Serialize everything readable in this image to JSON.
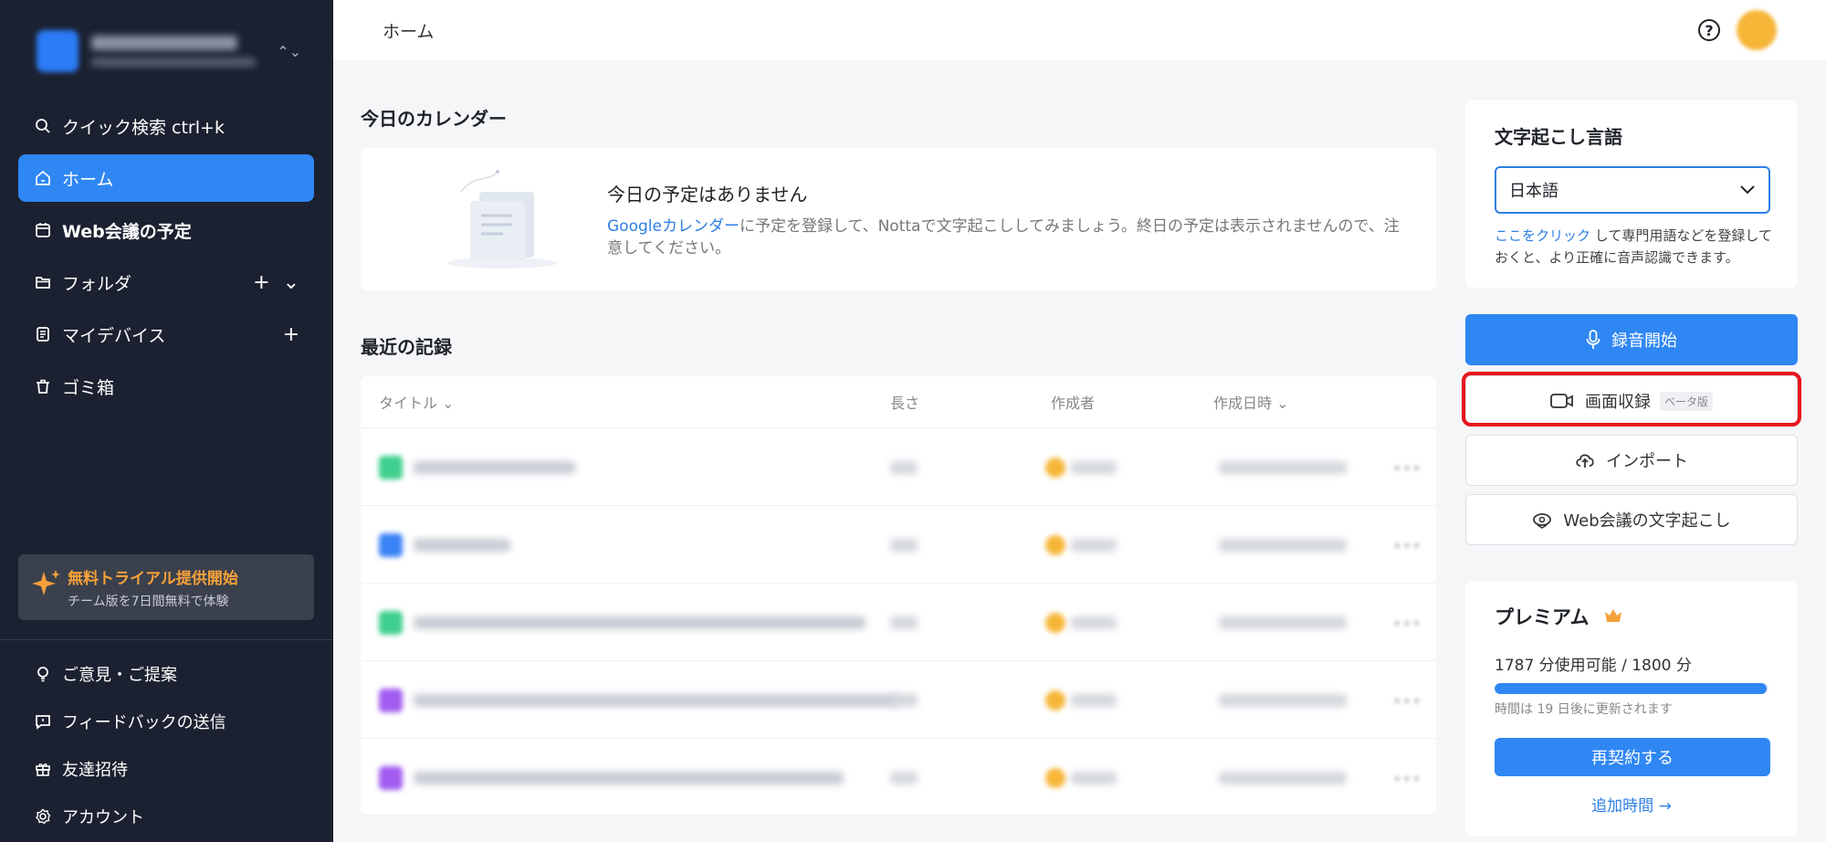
{
  "sidebar": {
    "workspace_toggle": "⌃⌄",
    "nav": [
      {
        "label": "クイック検索 ctrl+k",
        "icon": "search-icon"
      },
      {
        "label": "ホーム",
        "icon": "home-icon",
        "active": true
      },
      {
        "label": "Web会議の予定",
        "icon": "calendar-icon"
      },
      {
        "label": "フォルダ",
        "icon": "folder-icon",
        "actions": [
          "+",
          "⌄"
        ]
      },
      {
        "label": "マイデバイス",
        "icon": "device-icon",
        "actions": [
          "+"
        ]
      },
      {
        "label": "ゴミ箱",
        "icon": "trash-icon"
      }
    ],
    "trial": {
      "title": "無料トライアル提供開始",
      "subtitle": "チーム版を7日間無料で体験",
      "icon": "sparkle-icon"
    },
    "bottom": [
      {
        "label": "ご意見・ご提案",
        "icon": "lightbulb-icon"
      },
      {
        "label": "フィードバックの送信",
        "icon": "feedback-icon"
      },
      {
        "label": "友達招待",
        "icon": "gift-icon"
      },
      {
        "label": "アカウント",
        "icon": "gear-icon"
      }
    ]
  },
  "topbar": {
    "breadcrumb": "ホーム",
    "help": "?"
  },
  "calendar": {
    "section_title": "今日のカレンダー",
    "empty_title": "今日の予定はありません",
    "desc_link": "Googleカレンダー",
    "desc_rest": "に予定を登録して、Nottaで文字起こししてみましょう。終日の予定は表示されませんので、注意してください。"
  },
  "records": {
    "section_title": "最近の記録",
    "columns": {
      "title": "タイトル ⌄",
      "length": "長さ",
      "author": "作成者",
      "date": "作成日時 ⌄"
    },
    "rows": [
      {
        "icon_color": "#3fcf8e",
        "title_width": 0.15
      },
      {
        "icon_color": "#3b82f6",
        "title_width": 0.09
      },
      {
        "icon_color": "#3fcf8e",
        "title_width": 0.42
      },
      {
        "icon_color": "#a25cf0",
        "title_width": 0.45
      },
      {
        "icon_color": "#a25cf0",
        "title_width": 0.4
      }
    ]
  },
  "language": {
    "title": "文字起こし言語",
    "selected": "日本語",
    "note_link": "ここをクリック",
    "note_rest": " して専門用語などを登録しておくと、より正確に音声認識できます。"
  },
  "actions": {
    "record": "録音開始",
    "screen": "画面収録",
    "beta": "ベータ版",
    "import": "インポート",
    "web": "Web会議の文字起こし"
  },
  "premium": {
    "title": "プレミアム",
    "usage": "1787 分使用可能 / 1800 分",
    "usage_fraction": 0.993,
    "renew": "時間は 19 日後に更新されます",
    "renew_button": "再契約する",
    "add_time": "追加時間 →"
  }
}
